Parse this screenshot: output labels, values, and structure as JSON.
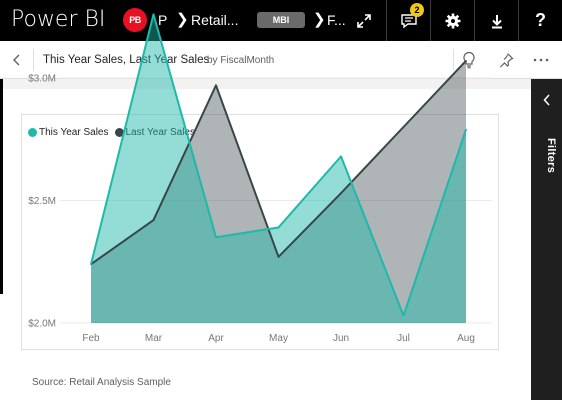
{
  "topbar": {
    "app_title": "Power BI",
    "workspace_initials": "PB",
    "crumb_1": "P",
    "crumb_2": "Retail...",
    "crumb_badge": "MBI",
    "crumb_3": "F...",
    "notification_count": "2",
    "icons": [
      "expand-icon",
      "notifications-icon",
      "settings-icon",
      "download-icon",
      "help-icon"
    ],
    "help_label": "?"
  },
  "subheader": {
    "title": "This Year Sales, Last Year Sales",
    "subtitle": "by FiscalMonth",
    "icons": [
      "back-icon",
      "insights-icon",
      "pin-icon",
      "more-options-icon"
    ]
  },
  "filters": {
    "label": "Filters"
  },
  "footer": {
    "source": "Source: Retail Analysis Sample"
  },
  "colors": {
    "this_year": "#1fb8aa",
    "last_year": "#374649",
    "brand_red": "#e81123",
    "notif": "#f2c811"
  },
  "chart_data": {
    "type": "area",
    "categories": [
      "Feb",
      "Mar",
      "Apr",
      "May",
      "Jun",
      "Jul",
      "Aug"
    ],
    "series": [
      {
        "name": "This Year Sales",
        "values": [
          2.24,
          3.26,
          2.35,
          2.39,
          2.68,
          2.03,
          2.79
        ]
      },
      {
        "name": "Last Year Sales",
        "values": [
          2.24,
          2.42,
          2.97,
          2.27,
          2.53,
          2.8,
          3.07
        ]
      }
    ],
    "yticks": [
      "$2.0M",
      "$2.5M",
      "$3.0M"
    ],
    "ytick_values": [
      2.0,
      2.5,
      3.0
    ],
    "ylim": [
      2.0,
      3.3
    ],
    "title": "",
    "xlabel": "",
    "ylabel": "",
    "legend": "top-left",
    "grid": true
  }
}
